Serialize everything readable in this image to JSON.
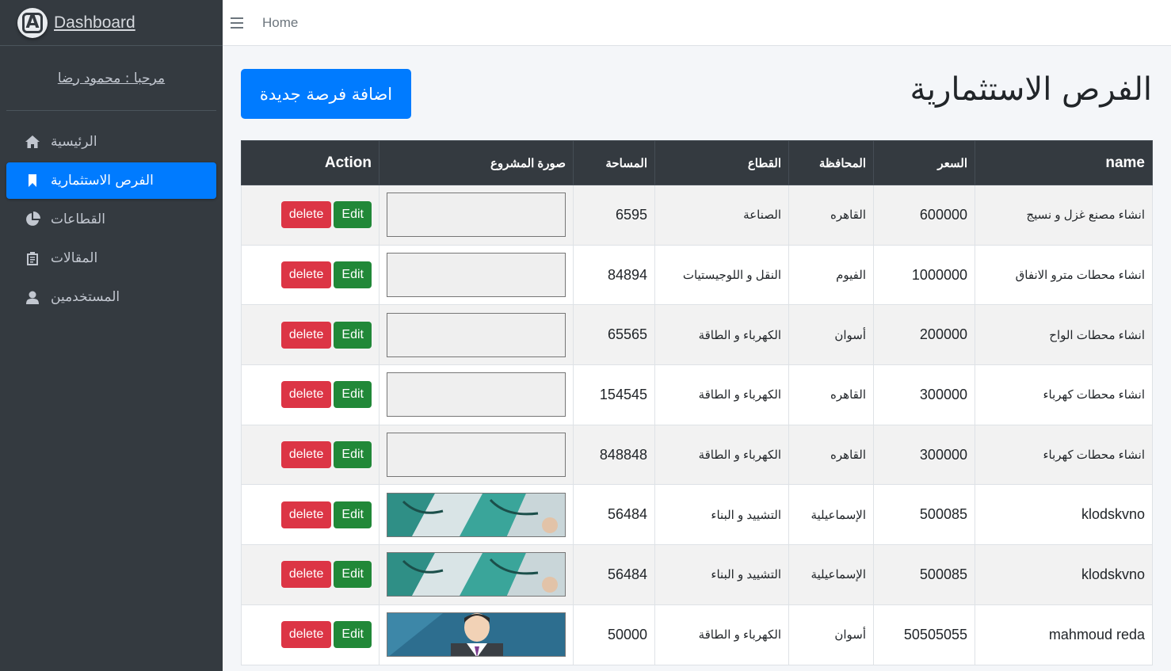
{
  "brand": {
    "logo_letter": "A",
    "title": "Dashboard"
  },
  "user_greeting": "مرحبا : محمود رضا",
  "sidebar": {
    "items": [
      {
        "label": "الرئيسية",
        "icon": "home-icon",
        "active": false
      },
      {
        "label": "الفرص الاستثمارية",
        "icon": "bookmark-icon",
        "active": true
      },
      {
        "label": "القطاعات",
        "icon": "pie-chart-icon",
        "active": false
      },
      {
        "label": "المقالات",
        "icon": "clipboard-icon",
        "active": false
      },
      {
        "label": "المستخدمين",
        "icon": "user-icon",
        "active": false
      }
    ]
  },
  "topbar": {
    "home_label": "Home"
  },
  "page": {
    "title": "الفرص الاستثمارية",
    "add_button": "اضافة فرصة جديدة"
  },
  "table": {
    "headers": {
      "name": "name",
      "price": "السعر",
      "governorate": "المحافظة",
      "sector": "القطاع",
      "area": "المساحة",
      "image": "صورة المشروع",
      "action": "Action"
    },
    "rows": [
      {
        "name": "انشاء مصنع غزل و نسيج",
        "price": "600000",
        "governorate": "القاهره",
        "sector": "الصناعة",
        "area": "6595",
        "image": "empty"
      },
      {
        "name": "انشاء محطات مترو الانفاق",
        "price": "1000000",
        "governorate": "الفيوم",
        "sector": "النقل و اللوجيستيات",
        "area": "84894",
        "image": "empty"
      },
      {
        "name": "انشاء محطات الواح",
        "price": "200000",
        "governorate": "أسوان",
        "sector": "الكهرباء و الطاقة",
        "area": "65565",
        "image": "empty"
      },
      {
        "name": "انشاء محطات كهرباء",
        "price": "300000",
        "governorate": "القاهره",
        "sector": "الكهرباء و الطاقة",
        "area": "154545",
        "image": "empty"
      },
      {
        "name": "انشاء محطات كهرباء",
        "price": "300000",
        "governorate": "القاهره",
        "sector": "الكهرباء و الطاقة",
        "area": "848848",
        "image": "empty"
      },
      {
        "name": "klodskvno",
        "price": "500085",
        "governorate": "الإسماعيلية",
        "sector": "التشييد و البناء",
        "area": "56484",
        "image": "medical-photo"
      },
      {
        "name": "klodskvno",
        "price": "500085",
        "governorate": "الإسماعيلية",
        "sector": "التشييد و البناء",
        "area": "56484",
        "image": "medical-photo"
      },
      {
        "name": "mahmoud reda",
        "price": "50505055",
        "governorate": "أسوان",
        "sector": "الكهرباء و الطاقة",
        "area": "50000",
        "image": "avatar-photo"
      }
    ],
    "edit_label": "Edit",
    "delete_label": "delete"
  },
  "colors": {
    "sidebar_bg": "#343a40",
    "primary": "#007bff",
    "edit": "#218838",
    "delete": "#dc3545",
    "table_head": "#343a40"
  }
}
